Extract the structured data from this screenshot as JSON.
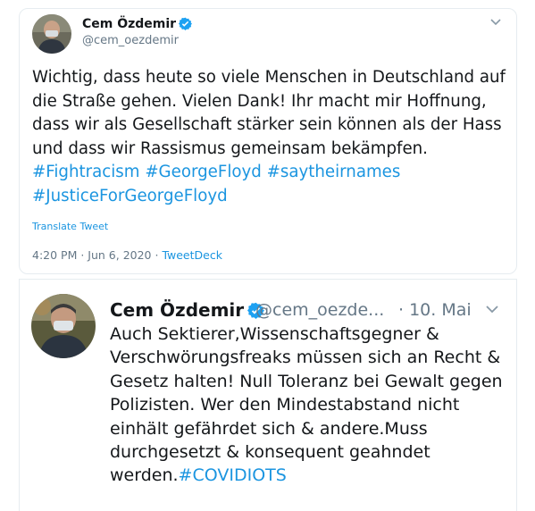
{
  "tweet1": {
    "name": "Cem Özdemir",
    "handle": "@cem_oezdemir",
    "text_before": "Wichtig, dass heute so viele Menschen in Deutschland auf die Straße gehen. Vielen Dank! Ihr macht mir Hoffnung, dass wir als Gesellschaft stärker sein können als der Hass und dass wir Rassismus gemeinsam bekämpfen. ",
    "hashtags": [
      "#Fightracism",
      "#GeorgeFloyd",
      "#saytheirnames",
      "#JusticeForGeorgeFloyd"
    ],
    "translate_label": "Translate Tweet",
    "time": "4:20 PM · Jun 6, 2020 · ",
    "source": "TweetDeck"
  },
  "tweet2": {
    "name": "Cem Özdemir",
    "handle": "@cem_oezde...",
    "date": "· 10. Mai",
    "text_before": "Auch Sektierer,Wissenschaftsgegner & Verschwörungsfreaks müssen sich an Recht & Gesetz halten! Null Toleranz bei Gewalt gegen Polizisten. Wer den Mindestabstand nicht einhält gefährdet sich & andere.Muss durchgesetzt & konsequent geahndet werden.",
    "hashtag": "#COVIDIOTS"
  },
  "colors": {
    "link": "#1b95e0",
    "secondary": "#657786",
    "verified": "#1da1f2"
  },
  "icons": {
    "verified": "verified-badge-icon",
    "menu": "chevron-down-icon"
  }
}
